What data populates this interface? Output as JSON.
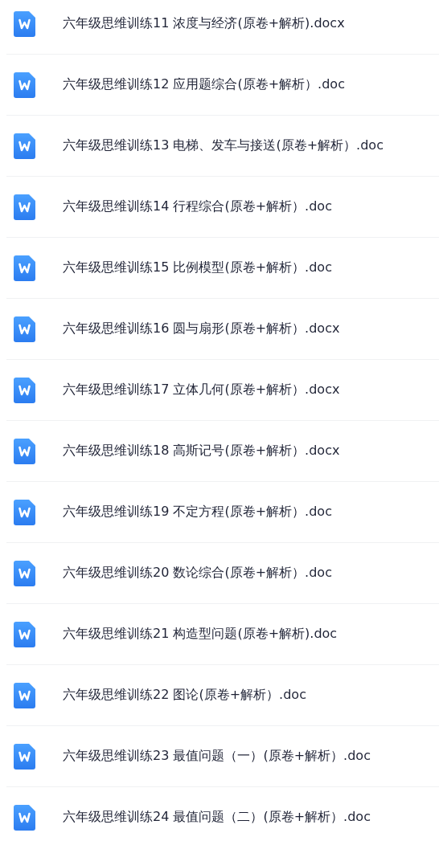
{
  "files": [
    {
      "name": "六年级思维训练11 浓度与经济(原卷+解析).docx"
    },
    {
      "name": "六年级思维训练12 应用题综合(原卷+解析）.doc"
    },
    {
      "name": "六年级思维训练13 电梯、发车与接送(原卷+解析）.doc"
    },
    {
      "name": "六年级思维训练14 行程综合(原卷+解析）.doc"
    },
    {
      "name": "六年级思维训练15 比例模型(原卷+解析）.doc"
    },
    {
      "name": "六年级思维训练16 圆与扇形(原卷+解析）.docx"
    },
    {
      "name": "六年级思维训练17 立体几何(原卷+解析）.docx"
    },
    {
      "name": "六年级思维训练18 高斯记号(原卷+解析）.docx"
    },
    {
      "name": "六年级思维训练19 不定方程(原卷+解析）.doc"
    },
    {
      "name": "六年级思维训练20 数论综合(原卷+解析）.doc"
    },
    {
      "name": "六年级思维训练21 构造型问题(原卷+解析).doc"
    },
    {
      "name": "六年级思维训练22 图论(原卷+解析）.doc"
    },
    {
      "name": "六年级思维训练23 最值问题（一）(原卷+解析）.doc"
    },
    {
      "name": "六年级思维训练24 最值问题（二）(原卷+解析）.doc"
    }
  ]
}
